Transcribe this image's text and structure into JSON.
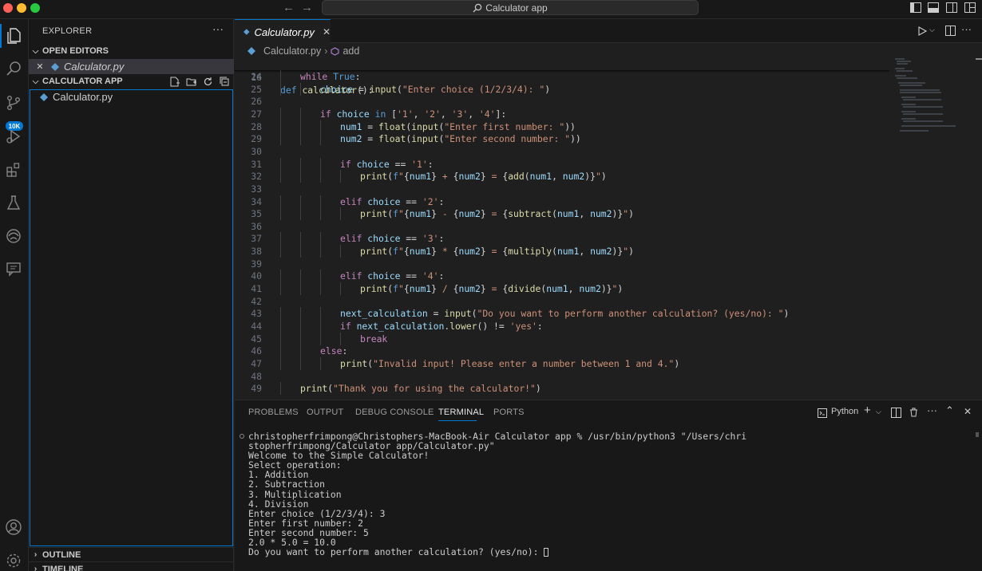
{
  "titlebar": {
    "command_center": "Calculator app",
    "icons": [
      "back-arrow-icon",
      "forward-arrow-icon",
      "search-icon",
      "toggle-primary-sidebar-icon",
      "toggle-panel-icon",
      "toggle-secondary-sidebar-icon",
      "customize-layout-icon"
    ]
  },
  "activity_bar": {
    "items": [
      "explorer-icon",
      "search-icon",
      "source-control-icon",
      "run-debug-icon",
      "extensions-icon",
      "testing-icon",
      "remote-explorer-icon",
      "chat-icon"
    ],
    "source_control_badge": "10K",
    "bottom": [
      "account-icon",
      "settings-gear-icon"
    ]
  },
  "sidebar": {
    "title": "EXPLORER",
    "more": "···",
    "open_editors": {
      "label": "OPEN EDITORS",
      "items": [
        {
          "name": "Calculator.py"
        }
      ]
    },
    "folder": {
      "label": "CALCULATOR APP",
      "items": [
        {
          "name": "Calculator.py"
        }
      ]
    },
    "outline_label": "OUTLINE",
    "timeline_label": "TIMELINE"
  },
  "editor": {
    "tab": {
      "label": "Calculator.py",
      "close": "✕"
    },
    "breadcrumb": {
      "file": "Calculator.py",
      "symbol": "add"
    },
    "sticky": {
      "line": "16",
      "text": "def calculator():"
    },
    "lines": [
      {
        "n": "24",
        "indent": 1,
        "tokens": [
          [
            "kw",
            "while "
          ],
          [
            "kw2",
            "True"
          ],
          [
            "op",
            ":"
          ]
        ]
      },
      {
        "n": "25",
        "indent": 2,
        "tokens": [
          [
            "var",
            "choice"
          ],
          [
            "op",
            " = "
          ],
          [
            "fn",
            "input"
          ],
          [
            "op",
            "("
          ],
          [
            "str",
            "\"Enter choice (1/2/3/4): \""
          ],
          [
            "op",
            ")"
          ]
        ]
      },
      {
        "n": "26",
        "indent": 0,
        "tokens": []
      },
      {
        "n": "27",
        "indent": 2,
        "tokens": [
          [
            "kw",
            "if "
          ],
          [
            "var",
            "choice"
          ],
          [
            "kw2",
            " in "
          ],
          [
            "op",
            "["
          ],
          [
            "str",
            "'1'"
          ],
          [
            "op",
            ", "
          ],
          [
            "str",
            "'2'"
          ],
          [
            "op",
            ", "
          ],
          [
            "str",
            "'3'"
          ],
          [
            "op",
            ", "
          ],
          [
            "str",
            "'4'"
          ],
          [
            "op",
            "]:"
          ]
        ]
      },
      {
        "n": "28",
        "indent": 3,
        "tokens": [
          [
            "var",
            "num1"
          ],
          [
            "op",
            " = "
          ],
          [
            "fn",
            "float"
          ],
          [
            "op",
            "("
          ],
          [
            "fn",
            "input"
          ],
          [
            "op",
            "("
          ],
          [
            "str",
            "\"Enter first number: \""
          ],
          [
            "op",
            "))"
          ]
        ]
      },
      {
        "n": "29",
        "indent": 3,
        "tokens": [
          [
            "var",
            "num2"
          ],
          [
            "op",
            " = "
          ],
          [
            "fn",
            "float"
          ],
          [
            "op",
            "("
          ],
          [
            "fn",
            "input"
          ],
          [
            "op",
            "("
          ],
          [
            "str",
            "\"Enter second number: \""
          ],
          [
            "op",
            "))"
          ]
        ]
      },
      {
        "n": "30",
        "indent": 0,
        "tokens": []
      },
      {
        "n": "31",
        "indent": 3,
        "tokens": [
          [
            "kw",
            "if "
          ],
          [
            "var",
            "choice"
          ],
          [
            "op",
            " == "
          ],
          [
            "str",
            "'1'"
          ],
          [
            "op",
            ":"
          ]
        ]
      },
      {
        "n": "32",
        "indent": 4,
        "tokens": [
          [
            "fn",
            "print"
          ],
          [
            "op",
            "("
          ],
          [
            "kw2",
            "f"
          ],
          [
            "str",
            "\""
          ],
          [
            "op",
            "{"
          ],
          [
            "var",
            "num1"
          ],
          [
            "op",
            "}"
          ],
          [
            "str",
            " + "
          ],
          [
            "op",
            "{"
          ],
          [
            "var",
            "num2"
          ],
          [
            "op",
            "}"
          ],
          [
            "str",
            " = "
          ],
          [
            "op",
            "{"
          ],
          [
            "fn",
            "add"
          ],
          [
            "op",
            "("
          ],
          [
            "var",
            "num1"
          ],
          [
            "op",
            ", "
          ],
          [
            "var",
            "num2"
          ],
          [
            "op",
            ")}"
          ],
          [
            "str",
            "\""
          ],
          [
            "op",
            ")"
          ]
        ]
      },
      {
        "n": "33",
        "indent": 0,
        "tokens": []
      },
      {
        "n": "34",
        "indent": 3,
        "tokens": [
          [
            "kw",
            "elif "
          ],
          [
            "var",
            "choice"
          ],
          [
            "op",
            " == "
          ],
          [
            "str",
            "'2'"
          ],
          [
            "op",
            ":"
          ]
        ]
      },
      {
        "n": "35",
        "indent": 4,
        "tokens": [
          [
            "fn",
            "print"
          ],
          [
            "op",
            "("
          ],
          [
            "kw2",
            "f"
          ],
          [
            "str",
            "\""
          ],
          [
            "op",
            "{"
          ],
          [
            "var",
            "num1"
          ],
          [
            "op",
            "}"
          ],
          [
            "str",
            " - "
          ],
          [
            "op",
            "{"
          ],
          [
            "var",
            "num2"
          ],
          [
            "op",
            "}"
          ],
          [
            "str",
            " = "
          ],
          [
            "op",
            "{"
          ],
          [
            "fn",
            "subtract"
          ],
          [
            "op",
            "("
          ],
          [
            "var",
            "num1"
          ],
          [
            "op",
            ", "
          ],
          [
            "var",
            "num2"
          ],
          [
            "op",
            ")}"
          ],
          [
            "str",
            "\""
          ],
          [
            "op",
            ")"
          ]
        ]
      },
      {
        "n": "36",
        "indent": 0,
        "tokens": []
      },
      {
        "n": "37",
        "indent": 3,
        "tokens": [
          [
            "kw",
            "elif "
          ],
          [
            "var",
            "choice"
          ],
          [
            "op",
            " == "
          ],
          [
            "str",
            "'3'"
          ],
          [
            "op",
            ":"
          ]
        ]
      },
      {
        "n": "38",
        "indent": 4,
        "tokens": [
          [
            "fn",
            "print"
          ],
          [
            "op",
            "("
          ],
          [
            "kw2",
            "f"
          ],
          [
            "str",
            "\""
          ],
          [
            "op",
            "{"
          ],
          [
            "var",
            "num1"
          ],
          [
            "op",
            "}"
          ],
          [
            "str",
            " * "
          ],
          [
            "op",
            "{"
          ],
          [
            "var",
            "num2"
          ],
          [
            "op",
            "}"
          ],
          [
            "str",
            " = "
          ],
          [
            "op",
            "{"
          ],
          [
            "fn",
            "multiply"
          ],
          [
            "op",
            "("
          ],
          [
            "var",
            "num1"
          ],
          [
            "op",
            ", "
          ],
          [
            "var",
            "num2"
          ],
          [
            "op",
            ")}"
          ],
          [
            "str",
            "\""
          ],
          [
            "op",
            ")"
          ]
        ]
      },
      {
        "n": "39",
        "indent": 0,
        "tokens": []
      },
      {
        "n": "40",
        "indent": 3,
        "tokens": [
          [
            "kw",
            "elif "
          ],
          [
            "var",
            "choice"
          ],
          [
            "op",
            " == "
          ],
          [
            "str",
            "'4'"
          ],
          [
            "op",
            ":"
          ]
        ]
      },
      {
        "n": "41",
        "indent": 4,
        "tokens": [
          [
            "fn",
            "print"
          ],
          [
            "op",
            "("
          ],
          [
            "kw2",
            "f"
          ],
          [
            "str",
            "\""
          ],
          [
            "op",
            "{"
          ],
          [
            "var",
            "num1"
          ],
          [
            "op",
            "}"
          ],
          [
            "str",
            " / "
          ],
          [
            "op",
            "{"
          ],
          [
            "var",
            "num2"
          ],
          [
            "op",
            "}"
          ],
          [
            "str",
            " = "
          ],
          [
            "op",
            "{"
          ],
          [
            "fn",
            "divide"
          ],
          [
            "op",
            "("
          ],
          [
            "var",
            "num1"
          ],
          [
            "op",
            ", "
          ],
          [
            "var",
            "num2"
          ],
          [
            "op",
            ")}"
          ],
          [
            "str",
            "\""
          ],
          [
            "op",
            ")"
          ]
        ]
      },
      {
        "n": "42",
        "indent": 0,
        "tokens": []
      },
      {
        "n": "43",
        "indent": 3,
        "tokens": [
          [
            "var",
            "next_calculation"
          ],
          [
            "op",
            " = "
          ],
          [
            "fn",
            "input"
          ],
          [
            "op",
            "("
          ],
          [
            "str",
            "\"Do you want to perform another calculation? (yes/no): \""
          ],
          [
            "op",
            ")"
          ]
        ]
      },
      {
        "n": "44",
        "indent": 3,
        "tokens": [
          [
            "kw",
            "if "
          ],
          [
            "var",
            "next_calculation"
          ],
          [
            "op",
            "."
          ],
          [
            "fn",
            "lower"
          ],
          [
            "op",
            "() != "
          ],
          [
            "str",
            "'yes'"
          ],
          [
            "op",
            ":"
          ]
        ]
      },
      {
        "n": "45",
        "indent": 4,
        "tokens": [
          [
            "kw",
            "break"
          ]
        ]
      },
      {
        "n": "46",
        "indent": 2,
        "tokens": [
          [
            "kw",
            "else"
          ],
          [
            "op",
            ":"
          ]
        ]
      },
      {
        "n": "47",
        "indent": 3,
        "tokens": [
          [
            "fn",
            "print"
          ],
          [
            "op",
            "("
          ],
          [
            "str",
            "\"Invalid input! Please enter a number between 1 and 4.\""
          ],
          [
            "op",
            ")"
          ]
        ]
      },
      {
        "n": "48",
        "indent": 0,
        "tokens": []
      },
      {
        "n": "49",
        "indent": 1,
        "tokens": [
          [
            "fn",
            "print"
          ],
          [
            "op",
            "("
          ],
          [
            "str",
            "\"Thank you for using the calculator!\""
          ],
          [
            "op",
            ")"
          ]
        ]
      }
    ],
    "actions": [
      "run-python-file-icon",
      "run-dropdown-icon",
      "split-editor-icon",
      "more-actions-icon"
    ]
  },
  "panel": {
    "tabs": [
      "PROBLEMS",
      "OUTPUT",
      "DEBUG CONSOLE",
      "TERMINAL",
      "PORTS"
    ],
    "active_tab": "TERMINAL",
    "terminal_name": "Python",
    "terminal": [
      "christopherfrimpong@Christophers-MacBook-Air Calculator app % /usr/bin/python3 \"/Users/chri",
      "stopherfrimpong/Calculator app/Calculator.py\"",
      "Welcome to the Simple Calculator!",
      "Select operation:",
      "1. Addition",
      "2. Subtraction",
      "3. Multiplication",
      "4. Division",
      "Enter choice (1/2/3/4): 3",
      "Enter first number: 2",
      "Enter second number: 5",
      "2.0 * 5.0 = 10.0",
      "Do you want to perform another calculation? (yes/no): "
    ]
  },
  "colors": {
    "accent": "#0078d4",
    "python_icon": "#5a9fd4"
  }
}
